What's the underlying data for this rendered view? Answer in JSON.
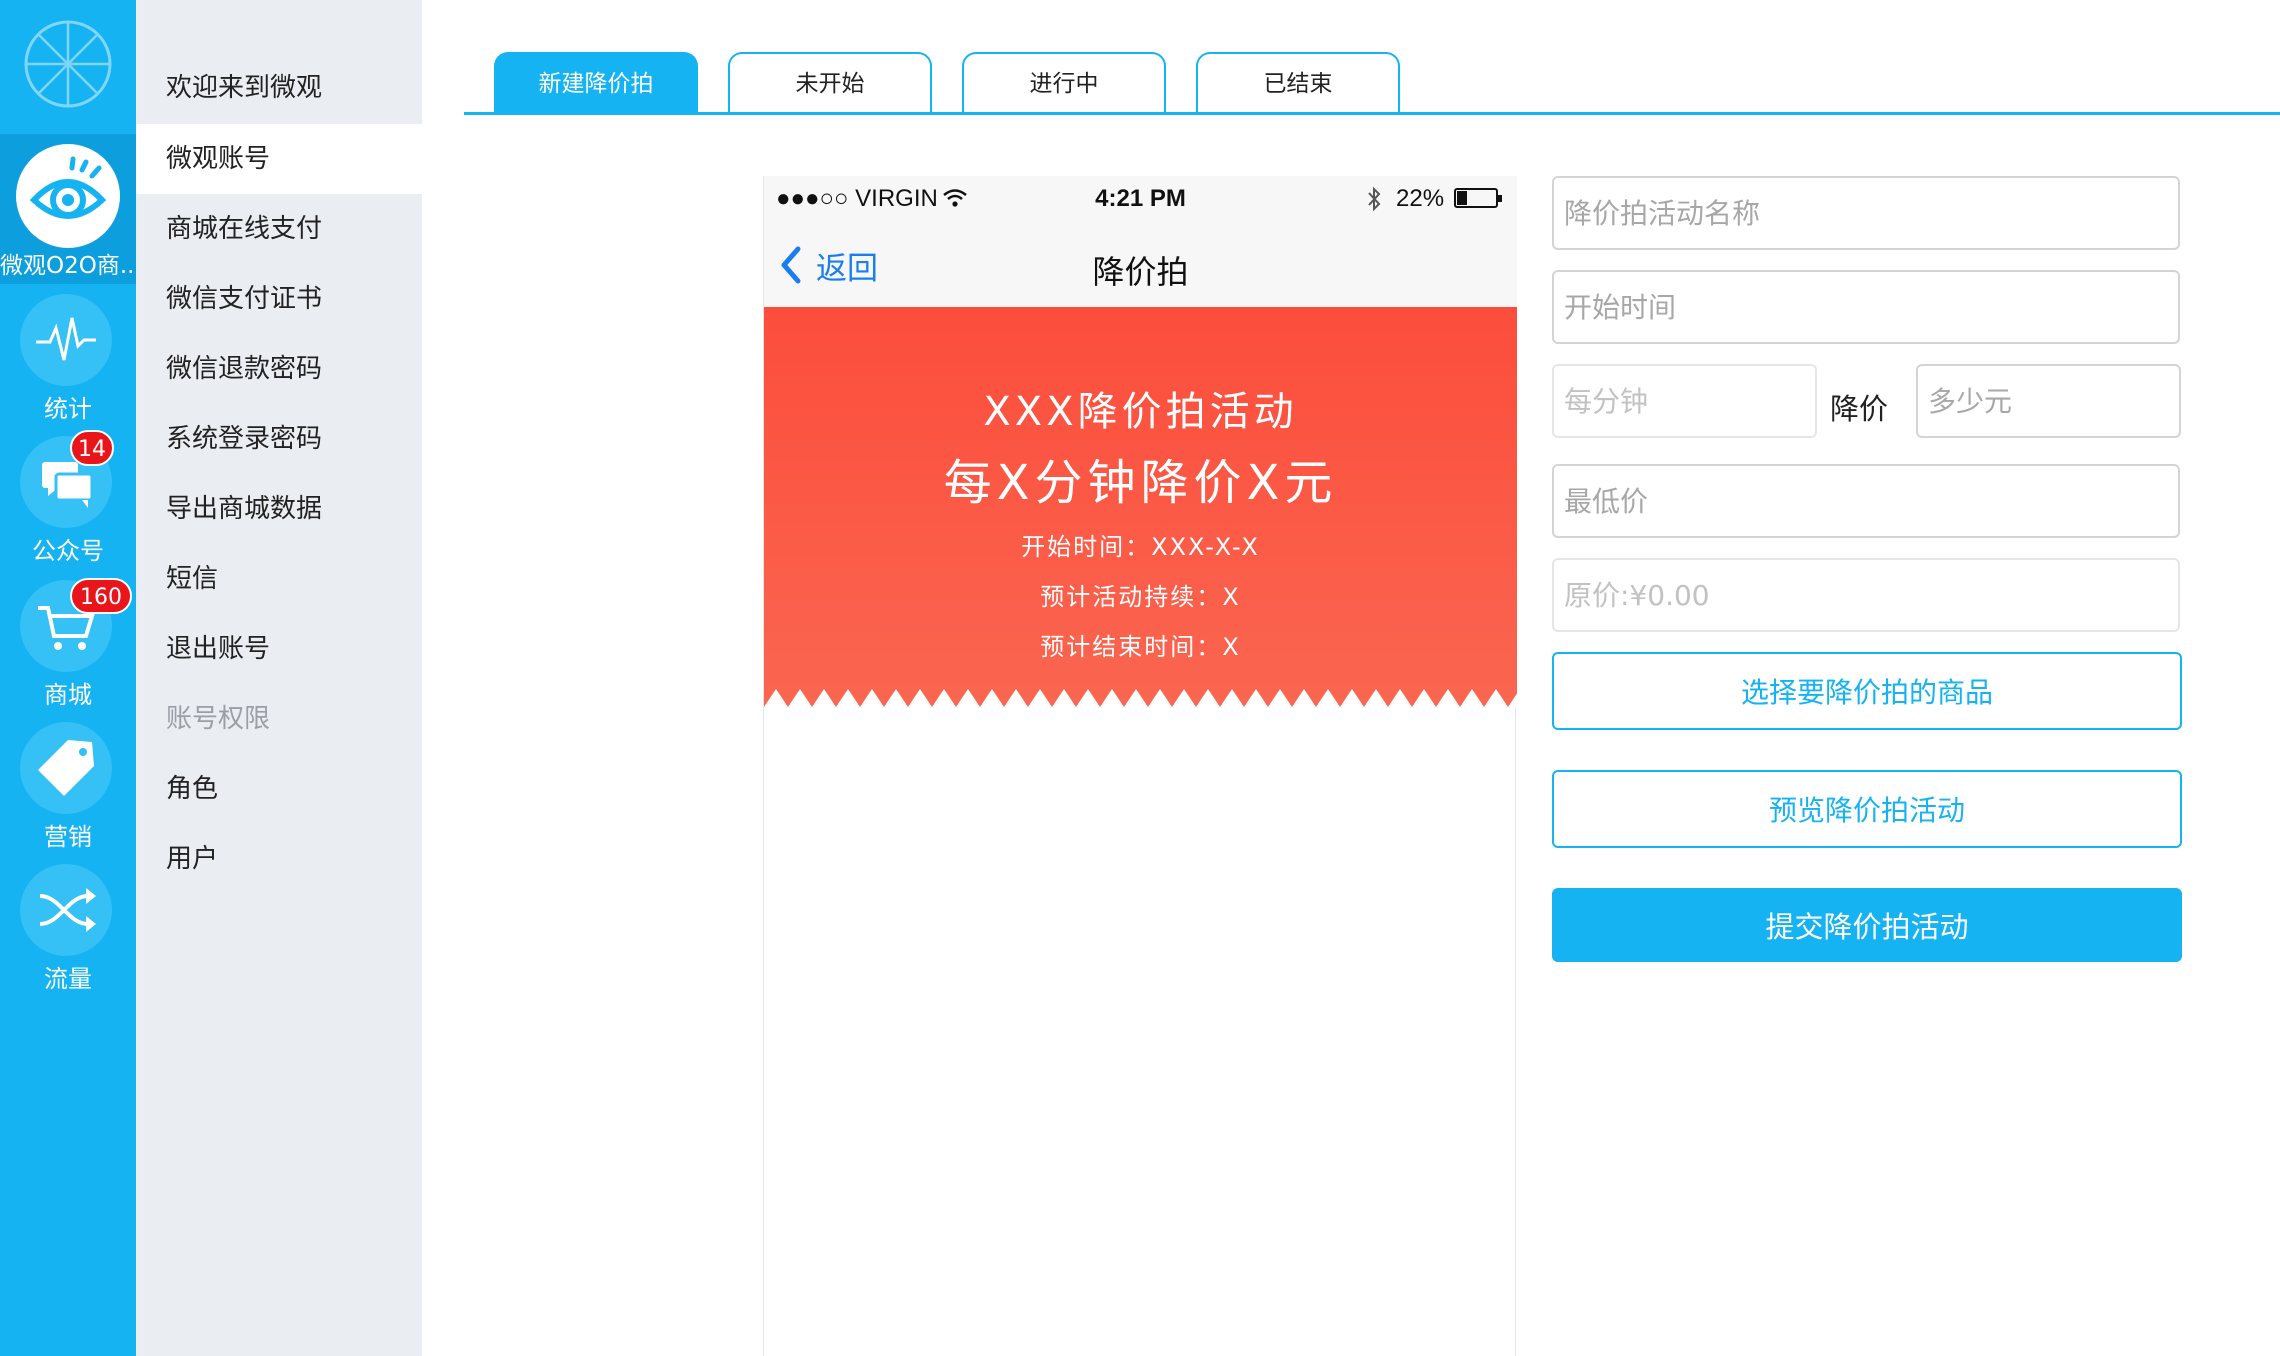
{
  "sidebar": {
    "brand_label": "微观O2O商...",
    "items": [
      {
        "label": "统计",
        "icon": "pulse-icon"
      },
      {
        "label": "公众号",
        "icon": "chat-bubbles-icon",
        "badge": "14"
      },
      {
        "label": "商城",
        "icon": "cart-icon",
        "badge": "160"
      },
      {
        "label": "营销",
        "icon": "tag-icon"
      },
      {
        "label": "流量",
        "icon": "shuffle-icon"
      }
    ]
  },
  "menu": {
    "items": [
      {
        "label": "欢迎来到微观"
      },
      {
        "label": "微观账号",
        "active": true
      },
      {
        "label": "商城在线支付"
      },
      {
        "label": "微信支付证书"
      },
      {
        "label": "微信退款密码"
      },
      {
        "label": "系统登录密码"
      },
      {
        "label": "导出商城数据"
      },
      {
        "label": "短信"
      },
      {
        "label": "退出账号"
      },
      {
        "label": "账号权限",
        "disabled": true
      },
      {
        "label": "角色"
      },
      {
        "label": "用户"
      }
    ]
  },
  "tabs": [
    {
      "label": "新建降价拍",
      "active": true
    },
    {
      "label": "未开始"
    },
    {
      "label": "进行中"
    },
    {
      "label": "已结束"
    }
  ],
  "phone": {
    "status": {
      "carrier": "●●●○○ VIRGIN",
      "time": "4:21 PM",
      "battery": "22%"
    },
    "nav": {
      "back_label": "返回",
      "title": "降价拍"
    },
    "promo": {
      "line1": "XXX降价拍活动",
      "line2": "每X分钟降价X元",
      "line3": "开始时间：XXX-X-X",
      "line4": "预计活动持续：X",
      "line5": "预计结束时间：X"
    }
  },
  "form": {
    "name_placeholder": "降价拍活动名称",
    "start_placeholder": "开始时间",
    "per_minute_placeholder": "每分钟",
    "drop_label": "降价",
    "amount_placeholder": "多少元",
    "min_price_placeholder": "最低价",
    "original_price_placeholder": "原价:¥0.00",
    "select_button": "选择要降价拍的商品",
    "preview_button": "预览降价拍活动",
    "submit_button": "提交降价拍活动"
  },
  "colors": {
    "accent": "#16b3f2",
    "promo": "#fc4d3c",
    "badge": "#e8161b",
    "menu_bg": "#eaedf2"
  }
}
